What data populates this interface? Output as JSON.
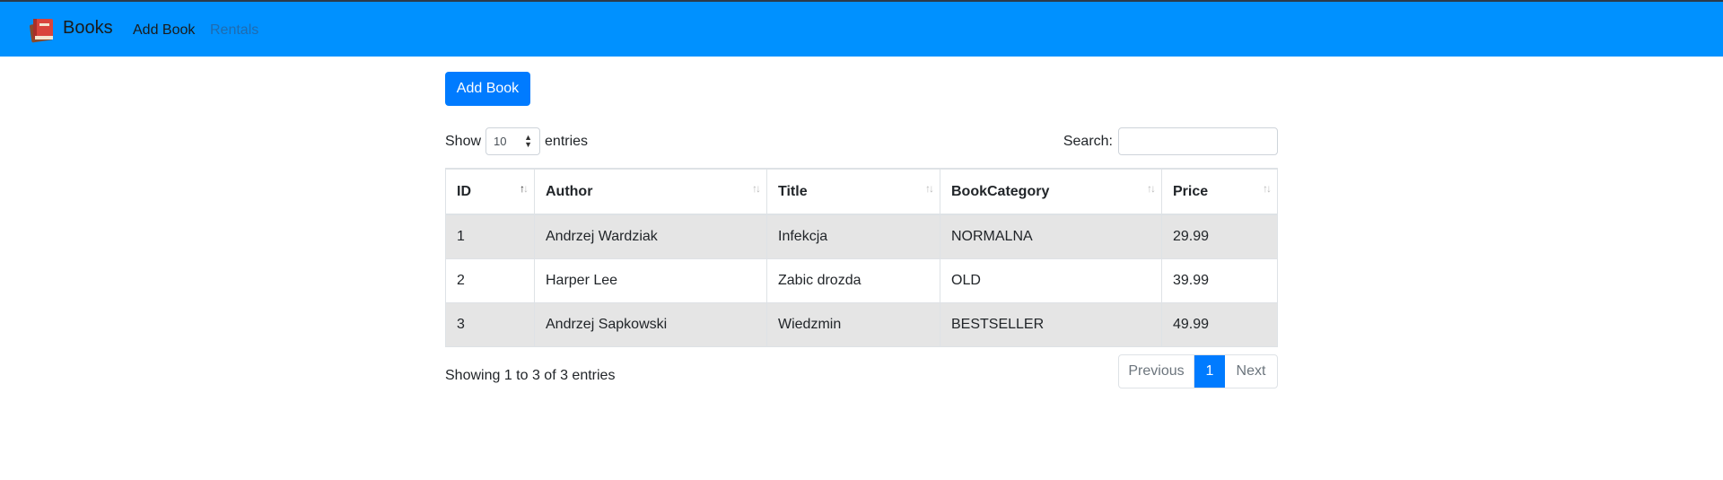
{
  "navbar": {
    "brand": "Books",
    "links": [
      "Add Book",
      "Rentals"
    ],
    "color": "#0091ff"
  },
  "toolbar": {
    "add_button": "Add Book"
  },
  "length": {
    "show_label": "Show",
    "value": "10",
    "entries_label": "entries"
  },
  "search": {
    "label": "Search:",
    "value": ""
  },
  "table": {
    "headers": [
      "ID",
      "Author",
      "Title",
      "BookCategory",
      "Price"
    ],
    "sorted_column": "ID",
    "rows": [
      [
        "1",
        "Andrzej Wardziak",
        "Infekcja",
        "NORMALNA",
        "29.99"
      ],
      [
        "2",
        "Harper Lee",
        "Zabic drozda",
        "OLD",
        "39.99"
      ],
      [
        "3",
        "Andrzej Sapkowski",
        "Wiedzmin",
        "BESTSELLER",
        "49.99"
      ]
    ]
  },
  "info": "Showing 1 to 3 of 3 entries",
  "pagination": {
    "previous": "Previous",
    "current": "1",
    "next": "Next"
  }
}
